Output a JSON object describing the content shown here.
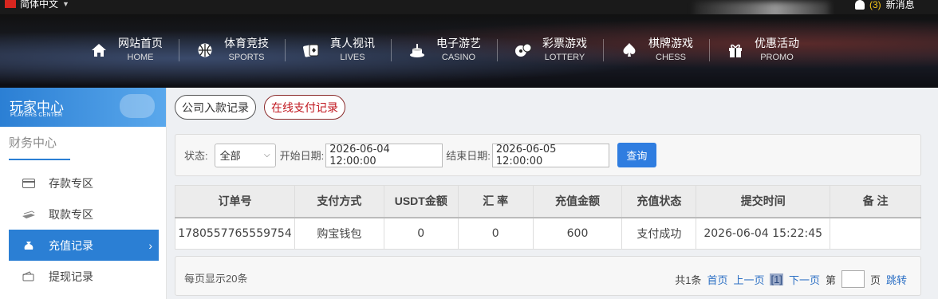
{
  "topbar": {
    "language": "简体中文",
    "message_count": "(3)",
    "message_label": "新消息"
  },
  "nav": [
    {
      "cn": "网站首页",
      "en": "HOME",
      "icon": "home-icon"
    },
    {
      "cn": "体育竞技",
      "en": "SPORTS",
      "icon": "basketball-icon"
    },
    {
      "cn": "真人视讯",
      "en": "LIVES",
      "icon": "cards-icon"
    },
    {
      "cn": "电子游艺",
      "en": "CASINO",
      "icon": "slot-icon"
    },
    {
      "cn": "彩票游戏",
      "en": "LOTTERY",
      "icon": "lottery-balls-icon"
    },
    {
      "cn": "棋牌游戏",
      "en": "CHESS",
      "icon": "spade-icon"
    },
    {
      "cn": "优惠活动",
      "en": "PROMO",
      "icon": "gift-icon"
    }
  ],
  "sidebar": {
    "header_cn": "玩家中心",
    "header_en": "PLAYERS CENTER",
    "section_title": "财务中心",
    "items": [
      {
        "label": "存款专区",
        "icon": "card-icon"
      },
      {
        "label": "取款专区",
        "icon": "cash-icon"
      },
      {
        "label": "充值记录",
        "icon": "moneybag-icon",
        "active": true
      },
      {
        "label": "提现记录",
        "icon": "wallet-icon"
      }
    ],
    "accent": "#2b7fd4"
  },
  "tabs": [
    {
      "label": "公司入款记录"
    },
    {
      "label": "在线支付记录",
      "active": true
    }
  ],
  "filter": {
    "status_label": "状态:",
    "status_value": "全部",
    "start_label": "开始日期:",
    "start_value": "2026-06-04 12:00:00",
    "end_label": "结束日期:",
    "end_value": "2026-06-05 12:00:00",
    "query_label": "查询"
  },
  "table": {
    "headers": [
      "订单号",
      "支付方式",
      "USDT金额",
      "汇 率",
      "充值金额",
      "充值状态",
      "提交时间",
      "备 注"
    ],
    "rows": [
      [
        "1780557765559754",
        "购宝钱包",
        "0",
        "0",
        "600",
        "支付成功",
        "2026-06-04 15:22:45",
        ""
      ]
    ]
  },
  "pager": {
    "per_page": "每页显示20条",
    "total": "共1条",
    "first": "首页",
    "prev": "上一页",
    "current": "[1]",
    "next": "下一页",
    "page_prefix": "第",
    "page_suffix": "页",
    "go": "跳转"
  }
}
